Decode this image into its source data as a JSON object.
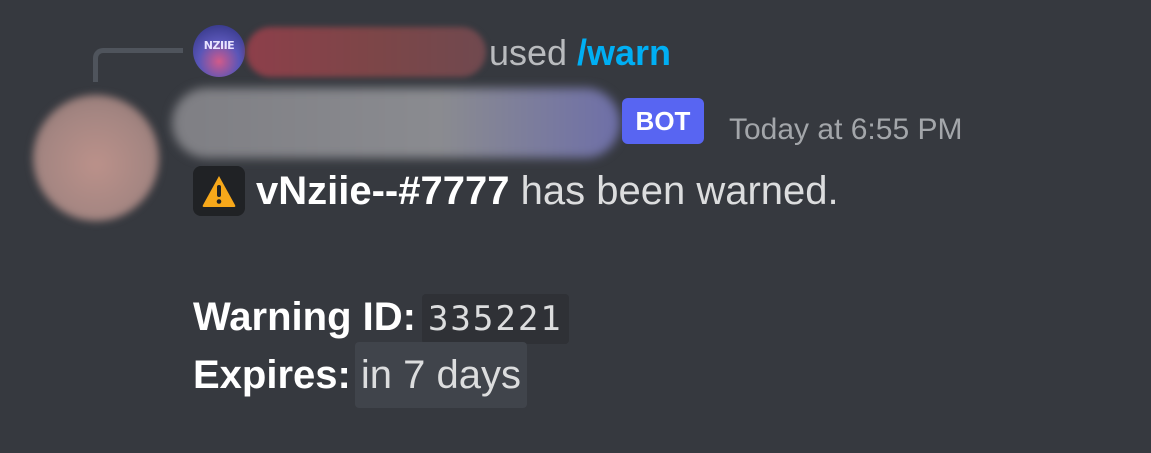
{
  "reply": {
    "avatar_text": "NZIIE",
    "used_text": "used",
    "command": "/warn"
  },
  "author": {
    "bot_tag": "BOT",
    "timestamp": "Today at 6:55 PM"
  },
  "content": {
    "target_user": "vNziie--#7777",
    "warn_text": "has been warned.",
    "warning_id_label": "Warning ID:",
    "warning_id_value": "335221",
    "expires_label": "Expires:",
    "expires_value": "in 7 days"
  },
  "icons": {
    "warning": "warning-triangle-icon"
  },
  "colors": {
    "background": "#36393f",
    "command": "#00aff4",
    "bot_tag": "#5865f2",
    "warning": "#f7a81a"
  }
}
